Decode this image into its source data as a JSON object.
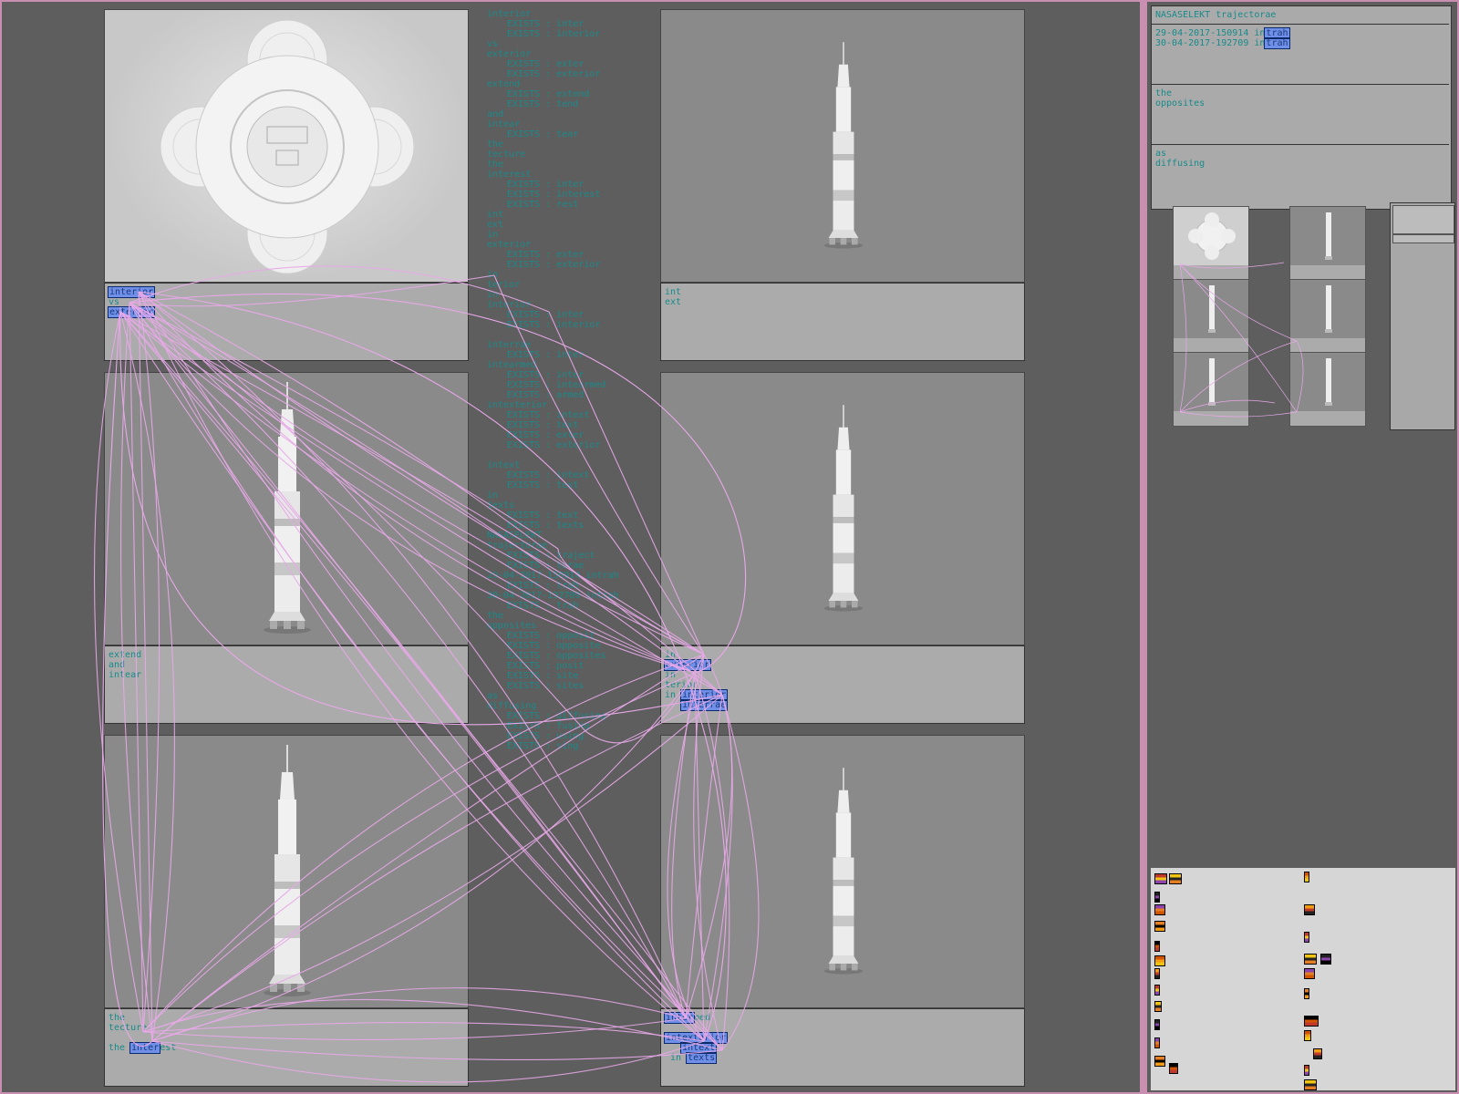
{
  "center_words": [
    {
      "t": "interior",
      "ind": false
    },
    {
      "t": "EXISTS : inter",
      "ind": true
    },
    {
      "t": "EXISTS : interior",
      "ind": true
    },
    {
      "t": "vs",
      "ind": false
    },
    {
      "t": "exterior",
      "ind": false
    },
    {
      "t": "EXISTS : exter",
      "ind": true
    },
    {
      "t": "EXISTS : exterior",
      "ind": true
    },
    {
      "t": "extend",
      "ind": false
    },
    {
      "t": "EXISTS : extend",
      "ind": true
    },
    {
      "t": "EXISTS : tend",
      "ind": true
    },
    {
      "t": "and",
      "ind": false
    },
    {
      "t": "intear",
      "ind": false
    },
    {
      "t": "EXISTS : tear",
      "ind": true
    },
    {
      "t": "the",
      "ind": false
    },
    {
      "t": "tecture",
      "ind": false
    },
    {
      "t": "the",
      "ind": false
    },
    {
      "t": "interest",
      "ind": false
    },
    {
      "t": "EXISTS : inter",
      "ind": true
    },
    {
      "t": "EXISTS : interest",
      "ind": true
    },
    {
      "t": "EXISTS : rest",
      "ind": true
    },
    {
      "t": "int",
      "ind": false
    },
    {
      "t": "ext",
      "ind": false
    },
    {
      "t": "in",
      "ind": false
    },
    {
      "t": "exterior",
      "ind": false
    },
    {
      "t": "EXISTS : exter",
      "ind": true
    },
    {
      "t": "EXISTS : exterior",
      "ind": true
    },
    {
      "t": "in",
      "ind": false
    },
    {
      "t": "terior",
      "ind": false
    },
    {
      "t": "in",
      "ind": false
    },
    {
      "t": "interior",
      "ind": false
    },
    {
      "t": "EXISTS : inter",
      "ind": true
    },
    {
      "t": "EXISTS : interior",
      "ind": true
    },
    {
      "t": "",
      "ind": false
    },
    {
      "t": "interrae",
      "ind": false
    },
    {
      "t": "EXISTS : inter",
      "ind": true
    },
    {
      "t": "intearmed",
      "ind": false
    },
    {
      "t": "EXISTS : inter",
      "ind": true
    },
    {
      "t": "EXISTS : intearmed",
      "ind": true
    },
    {
      "t": "EXISTS : armed",
      "ind": true
    },
    {
      "t": "intexterior",
      "ind": false
    },
    {
      "t": "EXISTS : intext",
      "ind": true
    },
    {
      "t": "EXISTS : text",
      "ind": true
    },
    {
      "t": "EXISTS : exter",
      "ind": true
    },
    {
      "t": "EXISTS : exterior",
      "ind": true
    },
    {
      "t": "",
      "ind": false
    },
    {
      "t": "intext",
      "ind": false
    },
    {
      "t": "EXISTS : intext",
      "ind": true
    },
    {
      "t": "EXISTS : text",
      "ind": true
    },
    {
      "t": "in",
      "ind": false
    },
    {
      "t": "texts",
      "ind": false
    },
    {
      "t": "EXISTS : text",
      "ind": true
    },
    {
      "t": "EXISTS : texts",
      "ind": true
    },
    {
      "t": "NASASELEKT",
      "ind": false
    },
    {
      "t": "trajectorae",
      "ind": false
    },
    {
      "t": "EXISTS : traject",
      "ind": true
    },
    {
      "t": "EXISTS : torae",
      "ind": true
    },
    {
      "t": "29-04-2017-150914 intrah",
      "ind": false
    },
    {
      "t": "EXISTS : trah",
      "ind": true
    },
    {
      "t": "30-04-2017-192709 intrah",
      "ind": false
    },
    {
      "t": "EXISTS : trah",
      "ind": true
    },
    {
      "t": "the",
      "ind": false
    },
    {
      "t": "opposites",
      "ind": false
    },
    {
      "t": "EXISTS : opposit",
      "ind": true
    },
    {
      "t": "EXISTS : opposite",
      "ind": true
    },
    {
      "t": "EXISTS : opposites",
      "ind": true
    },
    {
      "t": "EXISTS : posit",
      "ind": true
    },
    {
      "t": "EXISTS : site",
      "ind": true
    },
    {
      "t": "EXISTS : sites",
      "ind": true
    },
    {
      "t": "as",
      "ind": false
    },
    {
      "t": "diffusing",
      "ind": false
    },
    {
      "t": "EXISTS : diffusing",
      "ind": true
    },
    {
      "t": "EXISTS : fusing",
      "ind": true
    },
    {
      "t": "EXISTS : using",
      "ind": true
    },
    {
      "t": "EXISTS : sing",
      "ind": true
    }
  ],
  "panels": [
    {
      "id": "p1",
      "kind": "capsule",
      "tone": "light",
      "caption": [
        [
          {
            "t": "interior",
            "h": true
          }
        ],
        [
          {
            "t": "vs",
            "h": false
          }
        ],
        [
          {
            "t": "exterior",
            "h": true
          }
        ]
      ]
    },
    {
      "id": "p2",
      "kind": "rocket",
      "tone": "grey",
      "caption": [
        [
          {
            "t": "int",
            "h": false
          }
        ],
        [
          {
            "t": "ext",
            "h": false
          }
        ]
      ]
    },
    {
      "id": "p3",
      "kind": "rocket",
      "tone": "grey",
      "caption": [
        [
          {
            "t": "extend",
            "h": false
          }
        ],
        [
          {
            "t": "and",
            "h": false
          }
        ],
        [
          {
            "t": "intear",
            "h": false
          }
        ]
      ]
    },
    {
      "id": "p4",
      "kind": "rocket",
      "tone": "grey",
      "caption": [
        [
          {
            "t": "in",
            "h": false
          }
        ],
        [
          {
            "t": "exterior",
            "h": true
          }
        ],
        [
          {
            "t": "in",
            "h": false
          }
        ],
        [
          {
            "t": "terior",
            "h": false
          }
        ],
        [
          {
            "t": "in ",
            "h": false
          },
          {
            "t": "interior",
            "h": true
          }
        ],
        [
          {
            "t": "   ",
            "h": false
          },
          {
            "t": "interrae",
            "h": true
          }
        ]
      ]
    },
    {
      "id": "p5",
      "kind": "rocket",
      "tone": "grey",
      "caption": [
        [
          {
            "t": "the",
            "h": false
          }
        ],
        [
          {
            "t": "tecture",
            "h": false
          }
        ],
        [
          {
            "t": "",
            "h": false
          }
        ],
        [
          {
            "t": "the ",
            "h": false
          },
          {
            "t": "inter",
            "h": true
          },
          {
            "t": "est",
            "h": false
          }
        ]
      ]
    },
    {
      "id": "p6",
      "kind": "rocket",
      "tone": "grey",
      "caption": [
        [
          {
            "t": "inter",
            "h": true
          },
          {
            "t": "med",
            "h": false
          }
        ],
        [
          {
            "t": "",
            "h": false
          }
        ],
        [
          {
            "t": "intexterior",
            "h": true
          }
        ],
        [
          {
            "t": "   ",
            "h": false
          },
          {
            "t": "intext",
            "h": true
          }
        ],
        [
          {
            "t": " in ",
            "h": false
          },
          {
            "t": "texts",
            "h": true
          }
        ]
      ]
    }
  ],
  "sidebar": {
    "title": "NASASELEKT trajectorae",
    "dates": [
      {
        "pre": "29-04-2017-150914 in",
        "hl": "trah"
      },
      {
        "pre": "30-04-2017-192709 in",
        "hl": "trah"
      }
    ],
    "box2": [
      "the",
      "opposites"
    ],
    "box3": [
      "as",
      "diffusing"
    ]
  },
  "colors": {
    "accent": "#1a8a8a",
    "highlight": "#6f8fe8",
    "curve": "#e8a8e8",
    "background": "#5e5e5e",
    "frame": "#c88fb0"
  }
}
